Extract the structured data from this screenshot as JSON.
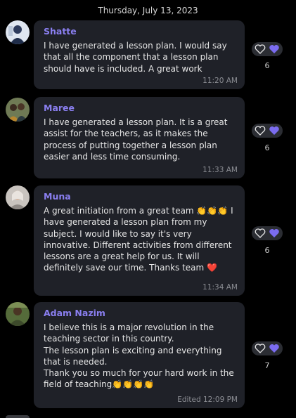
{
  "date_header": "Thursday, July 13, 2023",
  "colors": {
    "background": "#000000",
    "bubble": "#1f2128",
    "sender_name": "#8a7ff0",
    "reaction_heart": "#7b6cf0",
    "timestamp": "#8b8d93"
  },
  "icons": {
    "reaction_outline": "heart-outline-icon",
    "reaction_filled": "heart-filled-icon"
  },
  "messages": [
    {
      "sender": "Shatte",
      "text": "I have generated a lesson plan. I would say that all the component that a lesson plan should have is included. A great work",
      "time": "11:20 AM",
      "reaction_count": "6"
    },
    {
      "sender": "Maree",
      "text": "I have generated a lesson plan. It is a great assist for the teachers, as it makes the process of putting together a lesson plan easier and less time consuming.",
      "time": "11:33 AM",
      "reaction_count": "6"
    },
    {
      "sender": "Muna",
      "text": "A great initiation from a great team 👏👏👏 I have generated a lesson plan from my subject. I would like to say it's very innovative. Different activities from different lessons are a great help for us. It will definitely save our time. Thanks team ❤️",
      "time": "11:34 AM",
      "reaction_count": "6"
    },
    {
      "sender": "Adam Nazim",
      "text": "I believe this is a major revolution in the teaching sector in this country.\nThe lesson plan is exciting and everything that is needed.\nThank you so much for your hard work in the field of teaching👏👏👏👏",
      "time": "Edited 12:09 PM",
      "reaction_count": "7"
    }
  ]
}
